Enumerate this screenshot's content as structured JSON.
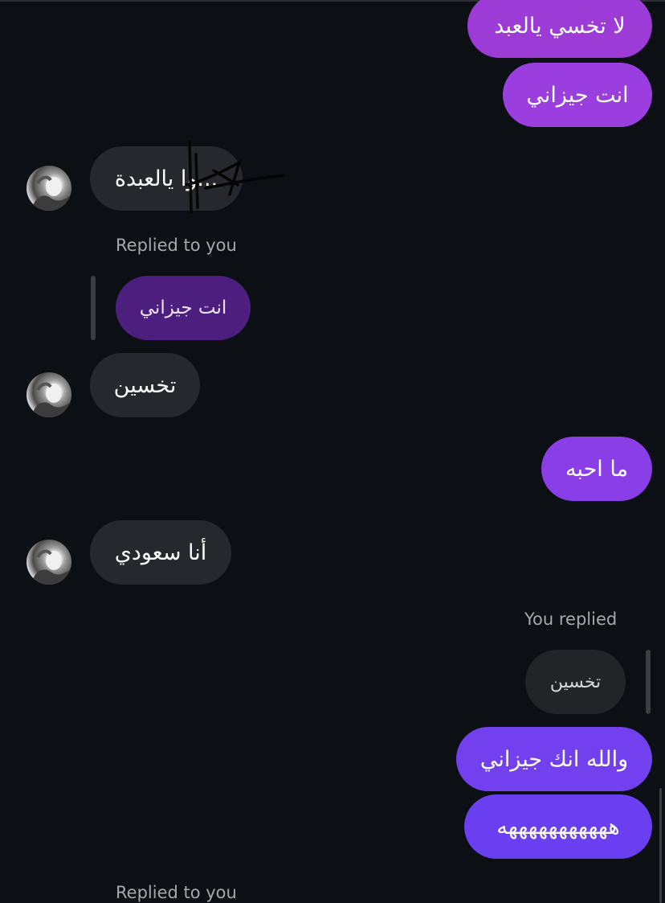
{
  "messages": [
    {
      "text": "لا تخسي يالعبد",
      "direction": "sent",
      "color": "#9c3bd6"
    },
    {
      "text": "انت جيزاني",
      "direction": "sent",
      "color": "#9a3ee0"
    },
    {
      "text": "...وا يالعبدة",
      "direction": "received"
    },
    {
      "reply_label": "Replied to you",
      "quoted_text": "انت جيزاني",
      "direction": "received-reply"
    },
    {
      "text": "تخسين",
      "direction": "received"
    },
    {
      "text": "ما احبه",
      "direction": "sent",
      "color": "#8a3ee8"
    },
    {
      "text": "أنا سعودي",
      "direction": "received"
    },
    {
      "reply_label": "You replied",
      "quoted_text": "تخسين",
      "direction": "sent-reply"
    },
    {
      "text": "والله انك جيزاني",
      "direction": "sent",
      "color": "#7240ef"
    },
    {
      "text": "هههههههههههه",
      "direction": "sent",
      "color": "#6a3ff2"
    },
    {
      "reply_label": "Replied to you",
      "direction": "received-reply"
    }
  ],
  "colors": {
    "background": "#0c0f14",
    "received_bubble": "#26282d",
    "reply_own_bubble": "#4c1f7e",
    "meta_text": "#a5a8ae"
  },
  "icons": {
    "avatar": "profile-photo",
    "doodle": "drawn-scribble-annotation"
  }
}
